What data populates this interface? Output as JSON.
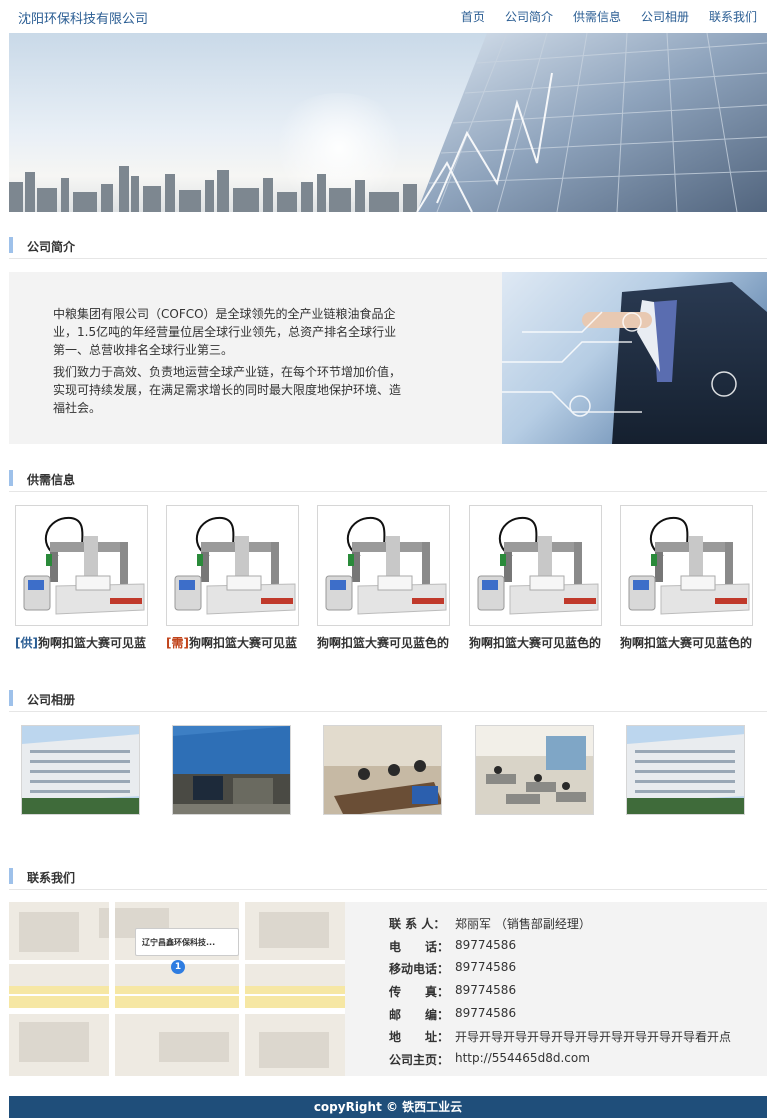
{
  "header": {
    "brand": "沈阳环保科技有限公司",
    "nav": [
      "首页",
      "公司简介",
      "供需信息",
      "公司相册",
      "联系我们"
    ]
  },
  "sections": {
    "about_title": "公司简介",
    "supply_title": "供需信息",
    "album_title": "公司相册",
    "contact_title": "联系我们"
  },
  "about": {
    "paragraph1": "中粮集团有限公司（COFCO）是全球领先的全产业链粮油食品企业，1.5亿吨的年经营量位居全球行业领先，总资产排名全球行业第一、总营收排名全球行业第三。",
    "paragraph2": "我们致力于高效、负责地运营全球产业链，在每个环节增加价值，实现可持续发展，在满足需求增长的同时最大限度地保护环境、造福社会。"
  },
  "products": [
    {
      "tag": "[供]",
      "tag_type": "supply",
      "title": "狗啊扣篮大赛可见蓝"
    },
    {
      "tag": "[需]",
      "tag_type": "demand",
      "title": "狗啊扣篮大赛可见蓝"
    },
    {
      "tag": "",
      "tag_type": "none",
      "title": "狗啊扣篮大赛可见蓝色的"
    },
    {
      "tag": "",
      "tag_type": "none",
      "title": "狗啊扣篮大赛可见蓝色的"
    },
    {
      "tag": "",
      "tag_type": "none",
      "title": "狗啊扣篮大赛可见蓝色的"
    }
  ],
  "contact": {
    "map_label": "辽宁昌鑫环保科技...",
    "map_pin": "1",
    "rows": [
      {
        "label": "联 系 人：",
        "value": "郑丽军 （销售部副经理）"
      },
      {
        "label": "电　　话：",
        "value": "89774586"
      },
      {
        "label": "移动电话：",
        "value": "89774586"
      },
      {
        "label": "传　　真：",
        "value": "89774586"
      },
      {
        "label": "邮　　编：",
        "value": "89774586"
      },
      {
        "label": "地　　址：",
        "value": "开导开导开导开导开导开导开导开导开导开导看开点"
      },
      {
        "label": "公司主页：",
        "value": "http://554465d8d.com"
      }
    ]
  },
  "footer": {
    "text": "copyRight © 铁西工业云"
  },
  "colors": {
    "brand_blue": "#2a5d93",
    "accent_bar": "#9ec1ea",
    "footer_bg": "#1f4e7a",
    "demand_tag": "#c1441b"
  }
}
